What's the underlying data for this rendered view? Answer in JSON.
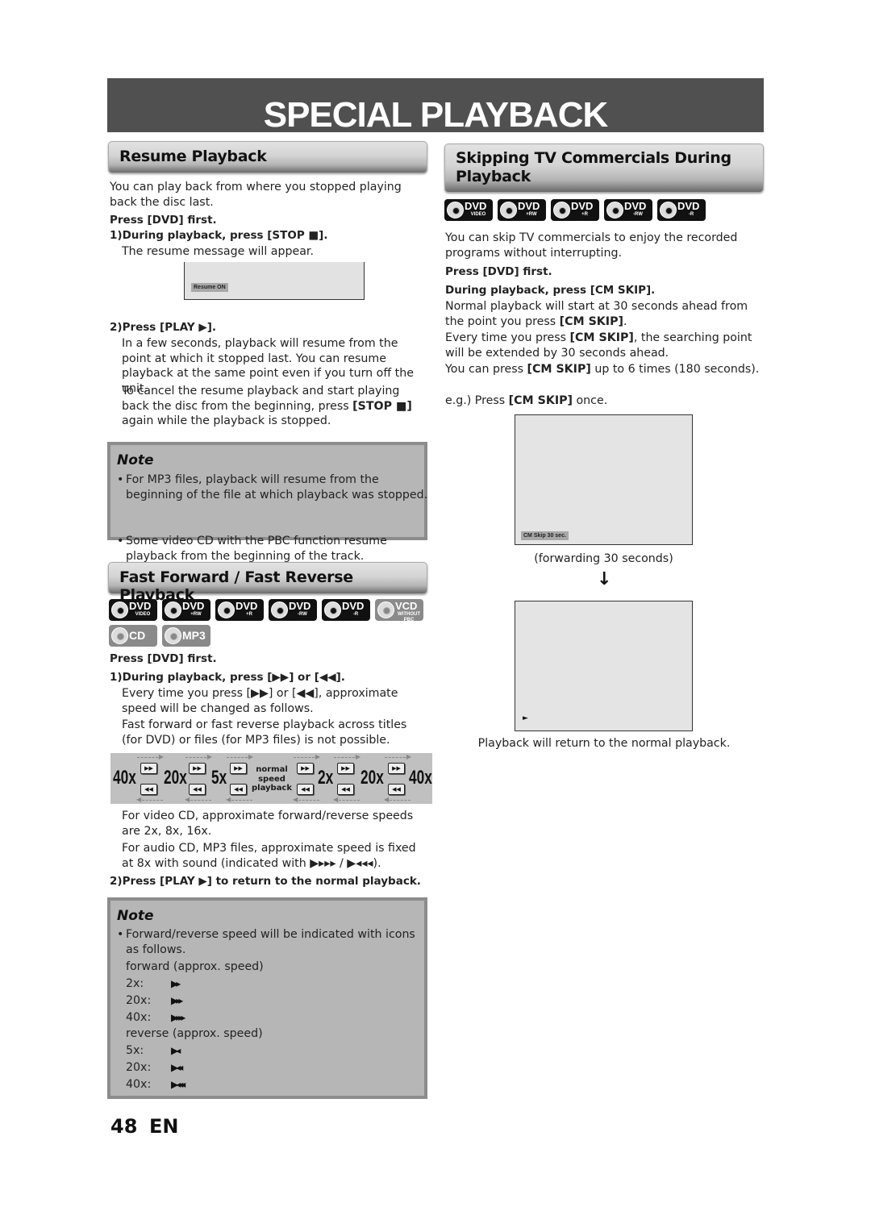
{
  "page": {
    "title": "SPECIAL PLAYBACK",
    "page_number": "48",
    "language": "EN"
  },
  "resume": {
    "heading": "Resume Playback",
    "intro": "You can play back from where you stopped playing back the disc last.",
    "press_dvd": "Press [DVD] first.",
    "step1": "1)During playback, press [STOP ■].",
    "step1_desc": "The resume message will appear.",
    "osd_text": "Resume ON",
    "step2": "2)Press [PLAY ▶].",
    "step2_desc1": "In a few seconds, playback will resume from the point at which it stopped last. You can resume playback at the same point even if you turn off the unit.",
    "step2_desc2_pre": "To cancel the resume playback and start playing back the disc from the beginning, press ",
    "step2_desc2_bold": "[STOP ■]",
    "step2_desc2_post": " again while the playback is stopped.",
    "note": {
      "title": "Note",
      "items": [
        "For MP3 files, playback will resume from the beginning of the file at which playback was stopped.",
        "Some video CD with the PBC function resume playback from the beginning of the track."
      ]
    }
  },
  "fast": {
    "heading": "Fast Forward / Fast Reverse Playback",
    "discs": [
      {
        "label": "DVD",
        "sub": "VIDEO",
        "style": "black"
      },
      {
        "label": "DVD",
        "sub": "+RW",
        "style": "black"
      },
      {
        "label": "DVD",
        "sub": "+R",
        "style": "black"
      },
      {
        "label": "DVD",
        "sub": "-RW",
        "style": "black"
      },
      {
        "label": "DVD",
        "sub": "-R",
        "style": "black"
      },
      {
        "label": "VCD",
        "sub": "WITHOUT PBC",
        "style": "gray"
      },
      {
        "label": "CD",
        "sub": "",
        "style": "gray"
      },
      {
        "label": "MP3",
        "sub": "",
        "style": "gray"
      }
    ],
    "press_dvd": "Press [DVD] first.",
    "step1": "1)During playback, press [▶▶] or [◀◀].",
    "step1_desc1": "Every time you press [▶▶] or [◀◀], approximate speed will be changed as follows.",
    "step1_desc2": "Fast forward or fast reverse playback across titles (for DVD) or files (for MP3 files) is not possible.",
    "speed_diagram": {
      "labels": [
        "40x",
        "20x",
        "5x",
        "2x",
        "20x",
        "40x"
      ],
      "center": [
        "normal",
        "speed",
        "playback"
      ],
      "fwd_key": "▶▶",
      "rev_key": "◀◀"
    },
    "vcd_desc": "For video CD, approximate forward/reverse speeds are 2x, 8x, 16x.",
    "cd_desc": "For audio CD, MP3 files, approximate speed is fixed at 8x with sound (indicated with ▶▸▸▸ / ▶◂◂◂).",
    "step2": "2)Press [PLAY ▶] to return to the normal playback.",
    "note": {
      "title": "Note",
      "intro": "Forward/reverse speed will be indicated with icons as follows.",
      "forward_title": "forward (approx. speed)",
      "forward": [
        {
          "speed": "2x:",
          "icon": "▶▸"
        },
        {
          "speed": "20x:",
          "icon": "▶▸▸"
        },
        {
          "speed": "40x:",
          "icon": "▶▸▸▸"
        }
      ],
      "reverse_title": "reverse (approx. speed)",
      "reverse": [
        {
          "speed": "5x:",
          "icon": "▶◂"
        },
        {
          "speed": "20x:",
          "icon": "▶◂◂"
        },
        {
          "speed": "40x:",
          "icon": "▶◂◂◂"
        }
      ]
    }
  },
  "cmskip": {
    "heading_line1": "Skipping TV Commercials During",
    "heading_line2": "Playback",
    "discs": [
      {
        "label": "DVD",
        "sub": "VIDEO"
      },
      {
        "label": "DVD",
        "sub": "+RW"
      },
      {
        "label": "DVD",
        "sub": "+R"
      },
      {
        "label": "DVD",
        "sub": "-RW"
      },
      {
        "label": "DVD",
        "sub": "-R"
      }
    ],
    "intro": "You can skip TV commercials to enjoy the recorded programs without interrupting.",
    "press_dvd": "Press [DVD] first.",
    "step": "During playback, press [CM SKIP].",
    "desc1_pre": "Normal playback will start at 30 seconds ahead from the point you press ",
    "desc1_bold": "[CM SKIP]",
    "desc1_post": ".",
    "desc2_pre": "Every time you press ",
    "desc2_bold": "[CM SKIP]",
    "desc2_post": ", the searching point will be extended by 30 seconds ahead.",
    "desc3_pre": "You can press ",
    "desc3_bold": "[CM SKIP]",
    "desc3_post": " up to 6 times (180 seconds).",
    "eg_pre": "e.g.) Press ",
    "eg_bold": "[CM SKIP]",
    "eg_post": " once.",
    "osd_text": "CM Skip 30 sec.",
    "caption1": "(forwarding 30 seconds)",
    "arrow": "↓",
    "play_glyph": "►",
    "caption2": "Playback will return to the normal playback."
  }
}
